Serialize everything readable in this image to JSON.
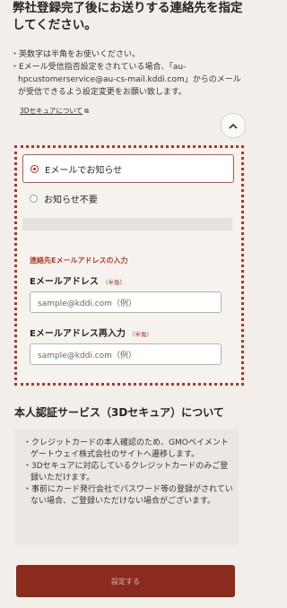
{
  "intro": {
    "heading_line1": "弊社登録完了後にお送りする連絡先を指定",
    "heading_line2": "してください。",
    "notes": [
      "・英数字は半角をお使いください。",
      "・Eメール受信指否設定をされている場合、「au-hpcustomerservice@au-cs-mail.kddi.com」からのメールが受信できるよう設定変更をお願い致します。"
    ]
  },
  "collapse_icon": "chevron-up-icon",
  "contact": {
    "options": [
      {
        "label": "Eメールでお知らせ",
        "selected": true
      },
      {
        "label": "お知らせ不要",
        "selected": false
      }
    ],
    "section_title": "連絡先Eメールアドレスの入力",
    "email_label": "Eメールアドレス",
    "email_half_note": "（半角）",
    "email_placeholder": "sample@kddi.com（例）",
    "email_confirm_label": "Eメールアドレス再入力",
    "email_confirm_half_note": "（半角）",
    "email_confirm_placeholder": "sample@kddi.com（例）"
  },
  "auth": {
    "title": "本人認証サービス（3Dセキュア）について",
    "notes": [
      "・クレジットカードの本人確認のため、GMOペイメントゲートウェイ株式会社のサイトへ遷移します。",
      "・3Dセキュアに対応しているクレジットカードのみご登録いただけます。",
      "・事前にカード発行会社でパスワード等の登録がされていない場合、ご登録いただけない場合がございます。"
    ],
    "link": "3Dセキュアについて"
  },
  "submit_label": "設定する",
  "colors": {
    "accent": "#c0301e",
    "button": "#8a2b1e"
  }
}
